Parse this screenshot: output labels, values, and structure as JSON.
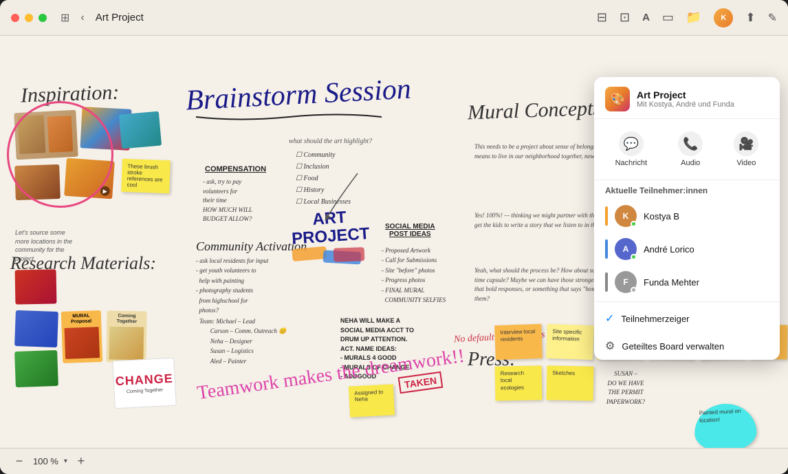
{
  "window": {
    "title": "Art Project",
    "zoom_level": "100 %"
  },
  "titlebar": {
    "back_label": "‹",
    "title": "Art Project",
    "sidebar_icon": "⊞",
    "table_icon": "⊟",
    "copy_icon": "⊡",
    "text_icon": "A",
    "media_icon": "⬜",
    "folder_icon": "📁",
    "share_icon": "↑",
    "edit_icon": "✎"
  },
  "collab_panel": {
    "project_name": "Art Project",
    "project_sub": "Mit Kostya, André und Funda",
    "actions": [
      {
        "label": "Nachricht",
        "icon": "💬"
      },
      {
        "label": "Audio",
        "icon": "📞"
      },
      {
        "label": "Video",
        "icon": "🎥"
      }
    ],
    "section_title": "Aktuelle Teilnehmer:innen",
    "participants": [
      {
        "name": "Kostya B",
        "color": "#f4a030",
        "avatar_bg": "#d08840",
        "initials": "K",
        "dot_color": "#44cc44"
      },
      {
        "name": "André Lorico",
        "color": "#4488dd",
        "avatar_bg": "#5566cc",
        "initials": "A",
        "dot_color": "#44cc44"
      },
      {
        "name": "Funda Mehter",
        "color": "#888888",
        "avatar_bg": "#888888",
        "initials": "F",
        "dot_color": "#aaaaaa"
      }
    ],
    "menu_items": [
      {
        "label": "Teilnehmerzeiger",
        "icon": "✓",
        "checked": true
      },
      {
        "label": "Geteiltes Board verwalten",
        "icon": "⚙"
      }
    ]
  },
  "canvas": {
    "inspiration_label": "Inspiration:",
    "brainstorm_title": "Brainstorm Session",
    "mural_concepts_title": "Mural Concepts",
    "research_label": "Research Materials:",
    "process_label": "Press:",
    "teamwork_text": "Teamwork makes the dreamwork!!",
    "art_project_text": "ART\nPROJECT",
    "compensation_text": "COMPENSATION",
    "community_activation": "Community Activation",
    "social_media": "SOCIAL MEDIA\nPOST IDEAS",
    "change_book": "CHANGE",
    "assigned_note": "Assigned to\nNeha",
    "taken_label": "TAKEN"
  },
  "zoom": {
    "minus": "−",
    "level": "100 %",
    "plus": "+"
  }
}
